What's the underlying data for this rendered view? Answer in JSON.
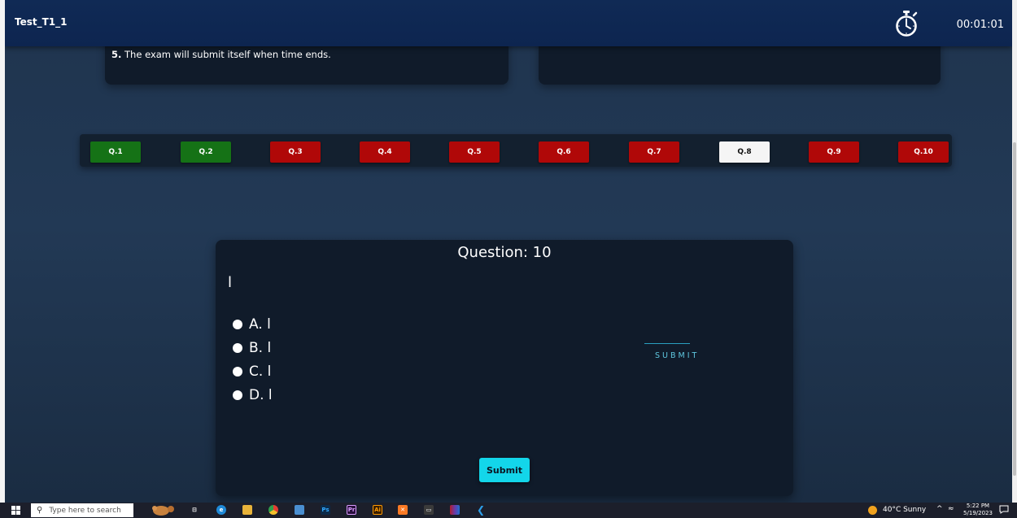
{
  "header": {
    "test_title": "Test_T1_1",
    "timer": "00:01:01"
  },
  "instructions": {
    "number": "5.",
    "text": " The exam will submit itself when time ends."
  },
  "question_nav": [
    {
      "label": "Q.1",
      "status": "green"
    },
    {
      "label": "Q.2",
      "status": "green"
    },
    {
      "label": "Q.3",
      "status": "red"
    },
    {
      "label": "Q.4",
      "status": "red"
    },
    {
      "label": "Q.5",
      "status": "red"
    },
    {
      "label": "Q.6",
      "status": "red"
    },
    {
      "label": "Q.7",
      "status": "red"
    },
    {
      "label": "Q.8",
      "status": "white"
    },
    {
      "label": "Q.9",
      "status": "red"
    },
    {
      "label": "Q.10",
      "status": "red"
    }
  ],
  "question": {
    "title": "Question: 10",
    "text": "l",
    "options": [
      "A. l",
      "B. l",
      "C. l",
      "D. l"
    ],
    "link_submit": "SUBMIT",
    "submit_button": "Submit"
  },
  "colors": {
    "answered": "#157216",
    "unanswered": "#b00808",
    "current": "#f5f5f5",
    "submit_button": "#13d6ea",
    "header": "#102a55"
  },
  "taskbar": {
    "search_placeholder": "Type here to search",
    "weather": "40°C  Sunny",
    "time": "5:22 PM",
    "date": "5/19/2023",
    "apps": [
      "monkey-app-icon",
      "task-view-icon",
      "edge-icon",
      "file-explorer-icon",
      "chrome-icon",
      "app-icon",
      "photoshop-icon",
      "premiere-icon",
      "illustrator-icon",
      "xampp-icon",
      "terminal-icon",
      "winrar-icon",
      "vscode-icon"
    ]
  }
}
